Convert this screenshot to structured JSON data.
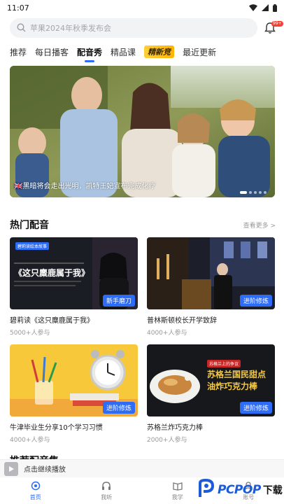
{
  "status_bar": {
    "time": "11:07"
  },
  "search": {
    "placeholder": "苹果2024年秋季发布会",
    "notification_badge": "99+"
  },
  "tabs": [
    {
      "label": "推荐",
      "active": false
    },
    {
      "label": "每日播客",
      "active": false
    },
    {
      "label": "配音秀",
      "active": true
    },
    {
      "label": "精品课",
      "active": false
    },
    {
      "label": "精新竞",
      "active": false,
      "special": true
    },
    {
      "label": "最近更新",
      "active": false
    }
  ],
  "banner": {
    "caption": "🇬🇧黑暗将会走出光明，凯特王妃宣布完成化疗",
    "slide_count": 5,
    "active_slide": 1
  },
  "hot_dubbing": {
    "title": "热门配音",
    "more_label": "查看更多 >",
    "cards": [
      {
        "title": "碧莉读《这只麋鹿属于我》",
        "participants": "5000+人参与",
        "level": "新手磨刀",
        "thumb_heading": "《这只麋鹿属于我》",
        "thumb_badge": "碧莉读绘本故事"
      },
      {
        "title": "普林斯顿校长开学致辞",
        "participants": "4000+人参与",
        "level": "进阶修炼"
      },
      {
        "title": "牛津毕业生分享10个学习习惯",
        "participants": "4000+人参与",
        "level": "进阶修炼"
      },
      {
        "title": "苏格兰炸巧克力棒",
        "participants": "2000+人参与",
        "level": "进阶修炼",
        "thumb_badge": "苏格兰上的争议",
        "thumb_heading_line1": "苏格兰国民甜点",
        "thumb_heading_line2": "油炸巧克力棒"
      }
    ]
  },
  "next_section": {
    "title": "推荐配音集"
  },
  "mini_player": {
    "label": "点击继续播放"
  },
  "bottom_nav": [
    {
      "label": "首页",
      "icon": "home-icon",
      "active": true
    },
    {
      "label": "我听",
      "icon": "headphones-icon",
      "active": false
    },
    {
      "label": "我学",
      "icon": "book-icon",
      "active": false
    },
    {
      "label": "账号",
      "icon": "user-icon",
      "active": false
    }
  ],
  "colors": {
    "accent": "#2d6cf6",
    "badge": "#ff3b30"
  },
  "watermark": {
    "brand": "PCPOP",
    "suffix": "下载"
  }
}
